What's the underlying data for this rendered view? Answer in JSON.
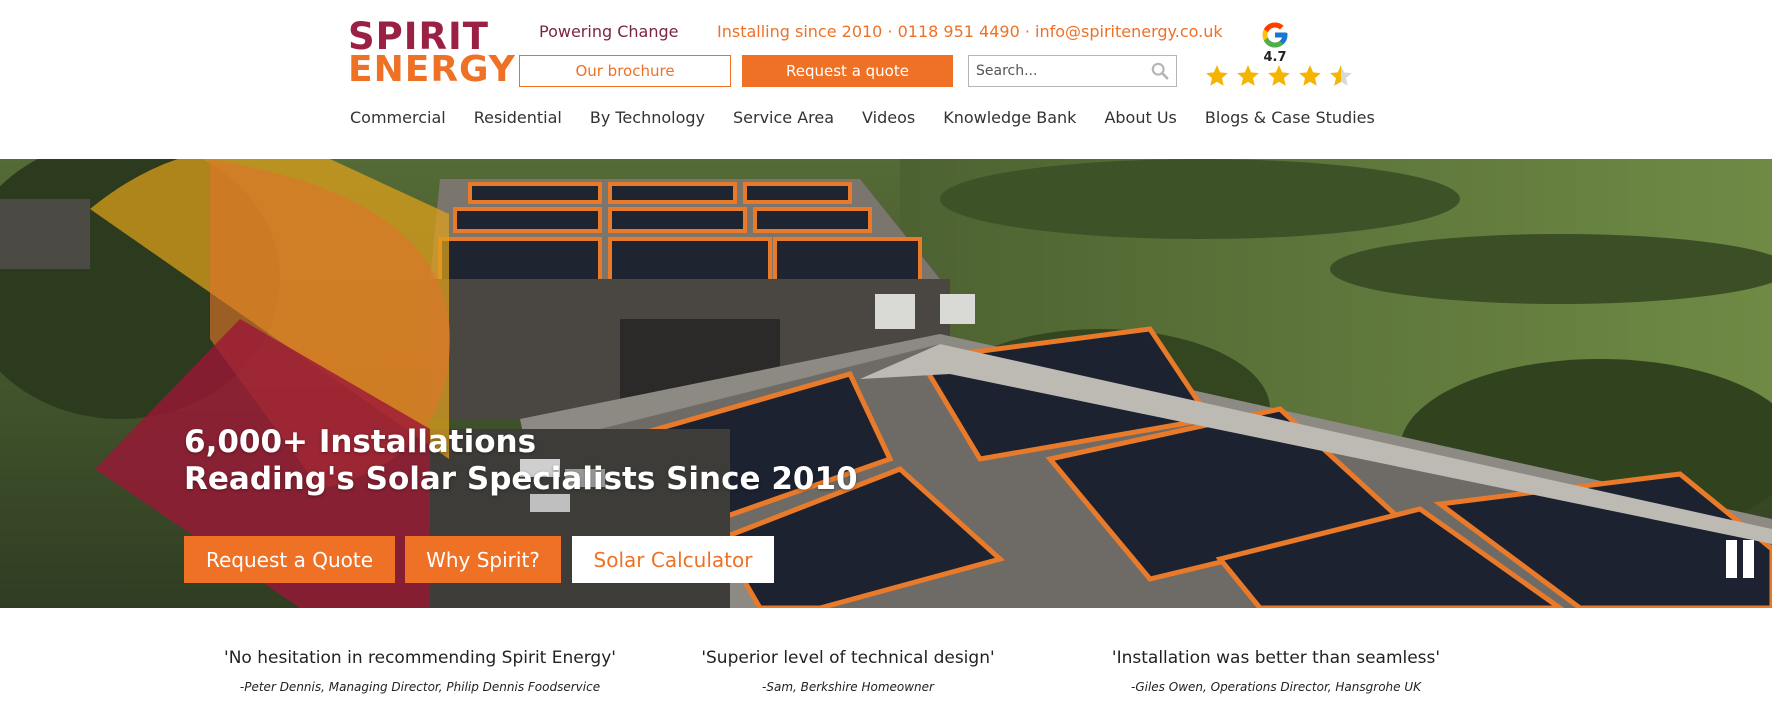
{
  "brand": {
    "logo_line1": "SPIRIT",
    "logo_line2": "ENERGY",
    "tagline": "Powering Change",
    "contact": "Installing since 2010 · 0118 951 4490 · info@spiritenergy.co.uk",
    "colors": {
      "primary_orange": "#ee7126",
      "brand_maroon": "#9a2143"
    }
  },
  "header": {
    "brochure_label": "Our brochure",
    "quote_label": "Request a quote",
    "search_placeholder": "Search...",
    "google_rating": "4.7",
    "stars": 4.5
  },
  "nav": [
    "Commercial",
    "Residential",
    "By Technology",
    "Service Area",
    "Videos",
    "Knowledge Bank",
    "About Us",
    "Blogs & Case Studies"
  ],
  "hero": {
    "headline_line1": "6,000+ Installations",
    "headline_line2": "Reading's Solar Specialists Since 2010",
    "buttons": [
      "Request a Quote",
      "Why Spirit?",
      "Solar Calculator"
    ]
  },
  "testimonials": [
    {
      "quote": "'No hesitation in recommending Spirit Energy'",
      "author": "-Peter Dennis, Managing Director, Philip Dennis Foodservice"
    },
    {
      "quote": "'Superior level of technical design'",
      "author": "-Sam, Berkshire Homeowner"
    },
    {
      "quote": "'Installation was better than seamless'",
      "author": "-Giles Owen, Operations Director, Hansgrohe UK"
    }
  ]
}
